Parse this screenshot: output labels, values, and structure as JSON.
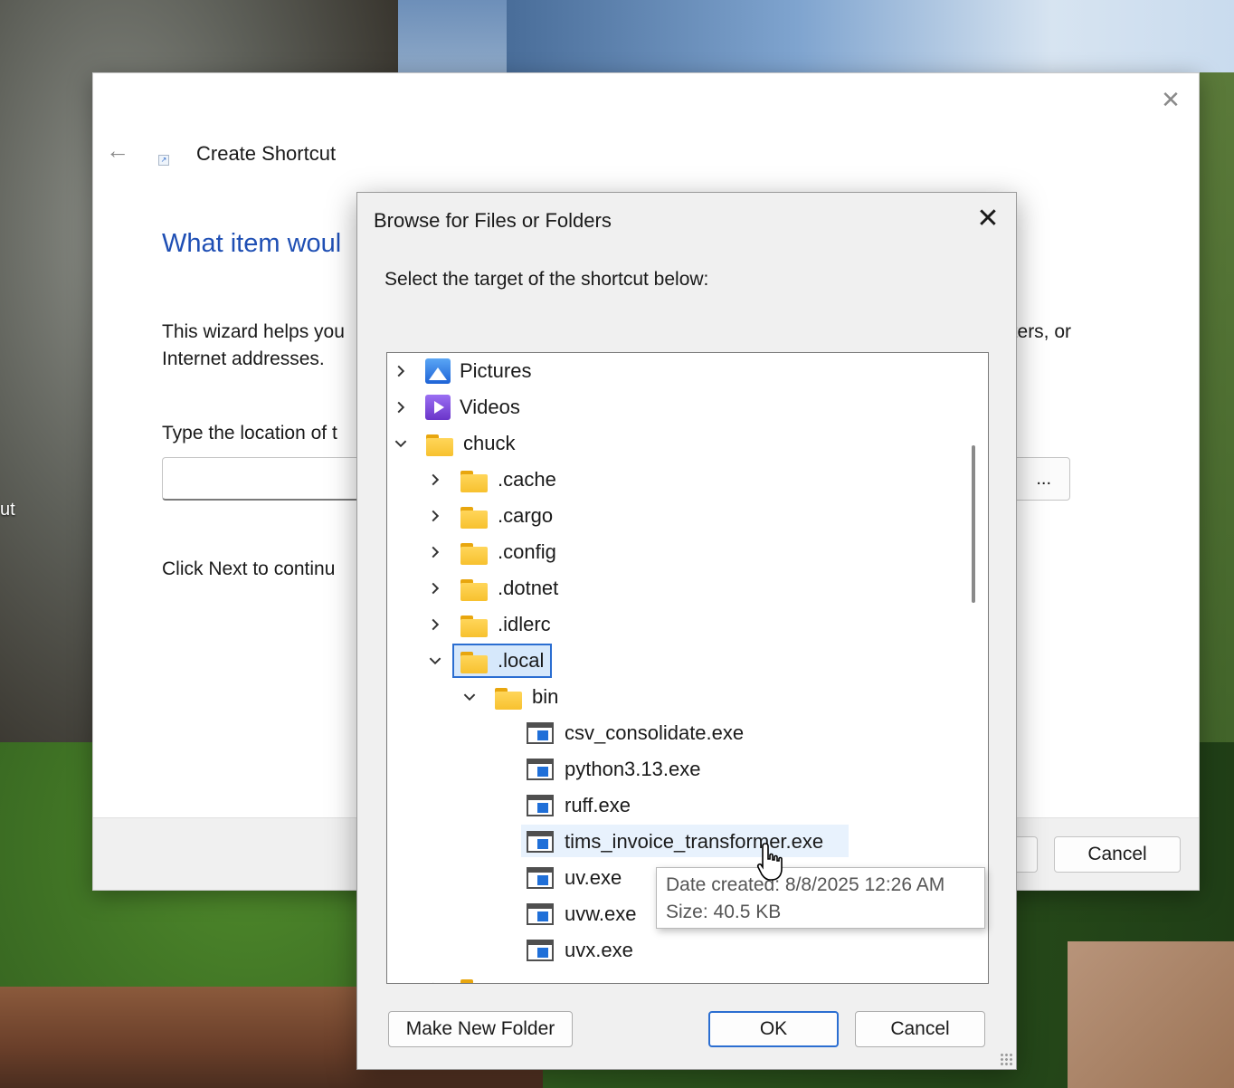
{
  "desktop": {
    "partial_label": "ut"
  },
  "wizard": {
    "window_title": "Create Shortcut",
    "heading": "What item woul",
    "description_line1_start": "This wizard helps you",
    "description_line1_end": "uters, or",
    "description_line2": "Internet addresses.",
    "type_location_label": "Type the location of t",
    "location_value": "",
    "browse_button_partial": "...",
    "click_next_text": "Click Next to continu",
    "cancel_label": "Cancel"
  },
  "browse_dialog": {
    "title": "Browse for Files or Folders",
    "instruction": "Select the target of the shortcut below:",
    "tree": [
      {
        "label": "Pictures",
        "type": "pictures",
        "expanded": false
      },
      {
        "label": "Videos",
        "type": "videos",
        "expanded": false
      },
      {
        "label": "chuck",
        "type": "folder",
        "expanded": true
      },
      {
        "label": ".cache",
        "type": "folder",
        "expanded": false
      },
      {
        "label": ".cargo",
        "type": "folder",
        "expanded": false
      },
      {
        "label": ".config",
        "type": "folder",
        "expanded": false
      },
      {
        "label": ".dotnet",
        "type": "folder",
        "expanded": false
      },
      {
        "label": ".idlerc",
        "type": "folder",
        "expanded": false
      },
      {
        "label": ".local",
        "type": "folder",
        "expanded": true,
        "selected": true
      },
      {
        "label": "bin",
        "type": "folder",
        "expanded": true
      },
      {
        "label": "csv_consolidate.exe",
        "type": "exe"
      },
      {
        "label": "python3.13.exe",
        "type": "exe"
      },
      {
        "label": "ruff.exe",
        "type": "exe"
      },
      {
        "label": "tims_invoice_transformer.exe",
        "type": "exe",
        "hovered": true
      },
      {
        "label": "uv.exe",
        "type": "exe"
      },
      {
        "label": "uvw.exe",
        "type": "exe"
      },
      {
        "label": "uvx.exe",
        "type": "exe"
      }
    ],
    "make_new_folder_label": "Make New Folder",
    "ok_label": "OK",
    "cancel_label": "Cancel"
  },
  "tooltip": {
    "date_created": "Date created: 8/8/2025 12:26 AM",
    "size": "Size: 40.5 KB"
  },
  "colors": {
    "accent": "#2b6ed1",
    "heading_blue": "#1f4fb4",
    "folder_yellow": "#f7c12f"
  }
}
